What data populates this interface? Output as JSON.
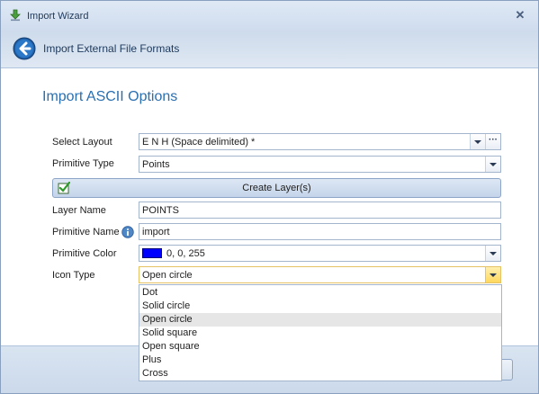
{
  "window": {
    "title": "Import Wizard"
  },
  "header": {
    "title": "Import External File Formats"
  },
  "main": {
    "section_title": "Import ASCII Options",
    "fields": {
      "select_layout": {
        "label": "Select Layout",
        "value": "E N H (Space delimited) *",
        "browse": "···"
      },
      "primitive_type": {
        "label": "Primitive Type",
        "value": "Points"
      },
      "create_layers": {
        "label": "Create Layer(s)"
      },
      "layer_name": {
        "label": "Layer Name",
        "value": "POINTS"
      },
      "primitive_name": {
        "label": "Primitive Name",
        "value": "import"
      },
      "primitive_color": {
        "label": "Primitive Color",
        "value": "0, 0, 255",
        "swatch": "#0000FF"
      },
      "icon_type": {
        "label": "Icon Type",
        "value": "Open circle"
      }
    },
    "icon_type_options": [
      "Dot",
      "Solid circle",
      "Open circle",
      "Solid square",
      "Open square",
      "Plus",
      "Cross"
    ],
    "icon_type_selected_index": 2
  },
  "icons": {
    "app": "wizard-download-icon",
    "close": "close-icon",
    "back": "back-arrow-icon",
    "info": "info-icon",
    "checkmark": "checkmark-icon"
  }
}
